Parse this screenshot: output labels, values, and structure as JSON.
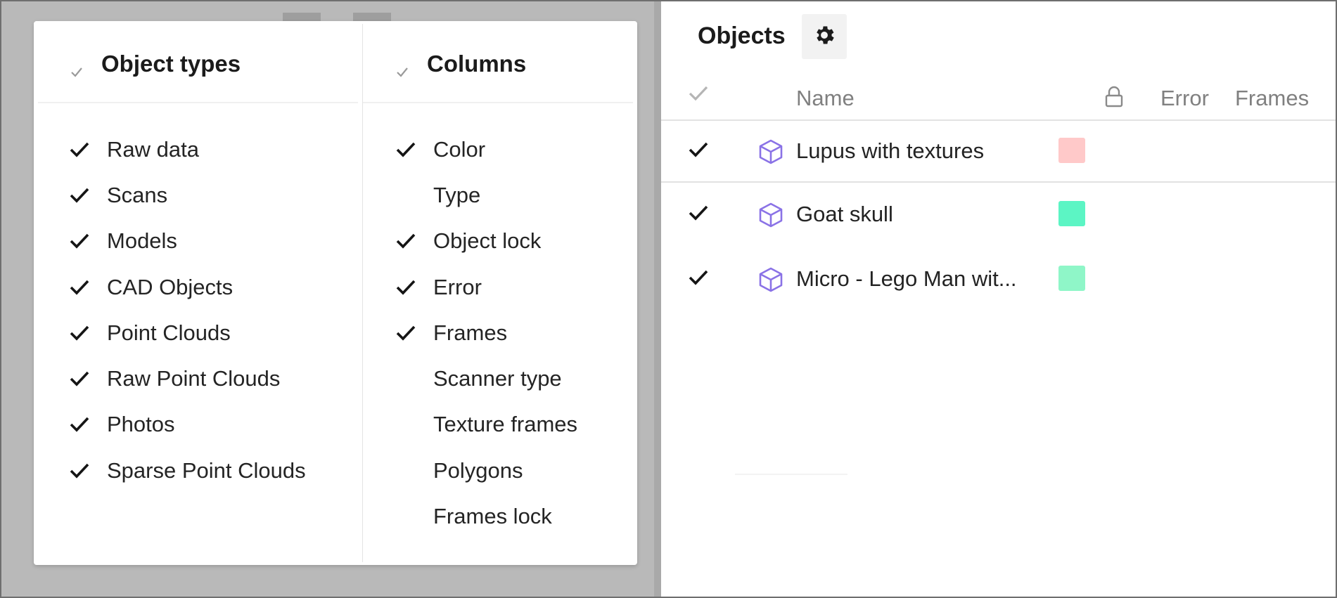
{
  "popup": {
    "object_types": {
      "title": "Object types",
      "items": [
        {
          "label": "Raw data",
          "checked": true
        },
        {
          "label": "Scans",
          "checked": true
        },
        {
          "label": "Models",
          "checked": true
        },
        {
          "label": "CAD Objects",
          "checked": true
        },
        {
          "label": "Point Clouds",
          "checked": true
        },
        {
          "label": "Raw Point Clouds",
          "checked": true
        },
        {
          "label": "Photos",
          "checked": true
        },
        {
          "label": "Sparse Point Clouds",
          "checked": true
        }
      ]
    },
    "columns": {
      "title": "Columns",
      "items": [
        {
          "label": "Color",
          "checked": true
        },
        {
          "label": "Type",
          "checked": false
        },
        {
          "label": "Object lock",
          "checked": true
        },
        {
          "label": "Error",
          "checked": true
        },
        {
          "label": "Frames",
          "checked": true
        },
        {
          "label": "Scanner type",
          "checked": false
        },
        {
          "label": "Texture frames",
          "checked": false
        },
        {
          "label": "Polygons",
          "checked": false
        },
        {
          "label": "Frames lock",
          "checked": false
        }
      ]
    }
  },
  "objects": {
    "title": "Objects",
    "settings_icon": "gear-icon",
    "headers": {
      "name": "Name",
      "lock_icon": "lock-icon",
      "error": "Error",
      "frames": "Frames"
    },
    "rows": [
      {
        "name": "Lupus with textures",
        "checked": true,
        "color": "#ffc9c9",
        "icon": "cube-icon"
      },
      {
        "name": "Goat skull",
        "checked": true,
        "color": "#5cf5c4",
        "icon": "cube-icon"
      },
      {
        "name": "Micro - Lego Man wit...",
        "checked": true,
        "color": "#8ff6c8",
        "icon": "cube-icon"
      }
    ]
  },
  "colors": {
    "accent_icon": "#8a72e6",
    "header_gray": "#808080",
    "background": "#b9b9b9"
  }
}
